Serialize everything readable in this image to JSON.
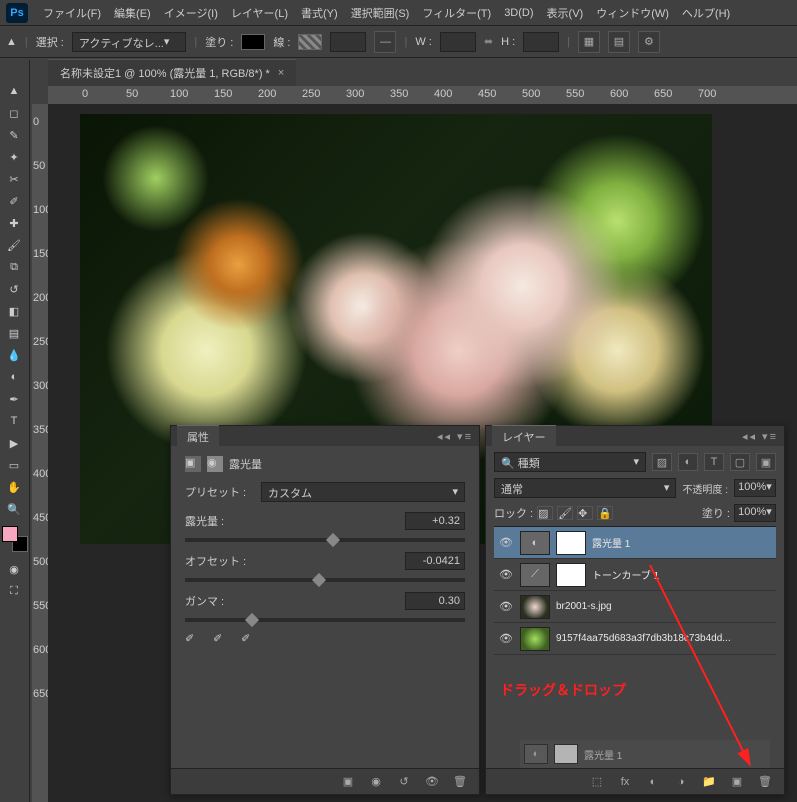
{
  "app": {
    "logo": "Ps"
  },
  "menu": [
    "ファイル(F)",
    "編集(E)",
    "イメージ(I)",
    "レイヤー(L)",
    "書式(Y)",
    "選択範囲(S)",
    "フィルター(T)",
    "3D(D)",
    "表示(V)",
    "ウィンドウ(W)",
    "ヘルプ(H)"
  ],
  "options": {
    "select_label": "選択 :",
    "select_value": "アクティブなレ...",
    "fill_label": "塗り :",
    "stroke_label": "線 :",
    "w_label": "W :",
    "h_label": "H :",
    "link_glyph": "⬌"
  },
  "document": {
    "tab_title": "名称未設定1 @ 100% (露光量 1, RGB/8*) *",
    "close": "×"
  },
  "ruler_h": [
    "0",
    "50",
    "100",
    "150",
    "200",
    "250",
    "300",
    "350",
    "400",
    "450",
    "500",
    "550",
    "600",
    "650",
    "700"
  ],
  "ruler_v": [
    "0",
    "50",
    "100",
    "150",
    "200",
    "250",
    "300",
    "350",
    "400",
    "450",
    "500",
    "550",
    "600",
    "650"
  ],
  "properties": {
    "title": "属性",
    "kind": "露光量",
    "preset_label": "プリセット :",
    "preset_value": "カスタム",
    "exposure_label": "露光量 :",
    "exposure_value": "+0.32",
    "offset_label": "オフセット :",
    "offset_value": "-0.0421",
    "gamma_label": "ガンマ :",
    "gamma_value": "0.30"
  },
  "layers": {
    "title": "レイヤー",
    "kind_select": "種類",
    "blend_mode": "通常",
    "opacity_label": "不透明度 :",
    "opacity_value": "100%",
    "lock_label": "ロック :",
    "fill_label": "塗り :",
    "fill_value": "100%",
    "items": [
      {
        "name": "露光量 1",
        "type": "adjust",
        "selected": true
      },
      {
        "name": "トーンカーブ 1",
        "type": "adjust",
        "selected": false
      },
      {
        "name": "br2001-s.jpg",
        "type": "image1",
        "selected": false
      },
      {
        "name": "9157f4aa75d683a3f7db3b18c73b4dd...",
        "type": "image2",
        "selected": false
      }
    ],
    "ghost_name": "露光量 1"
  },
  "annotation": "ドラッグ＆ドロップ"
}
